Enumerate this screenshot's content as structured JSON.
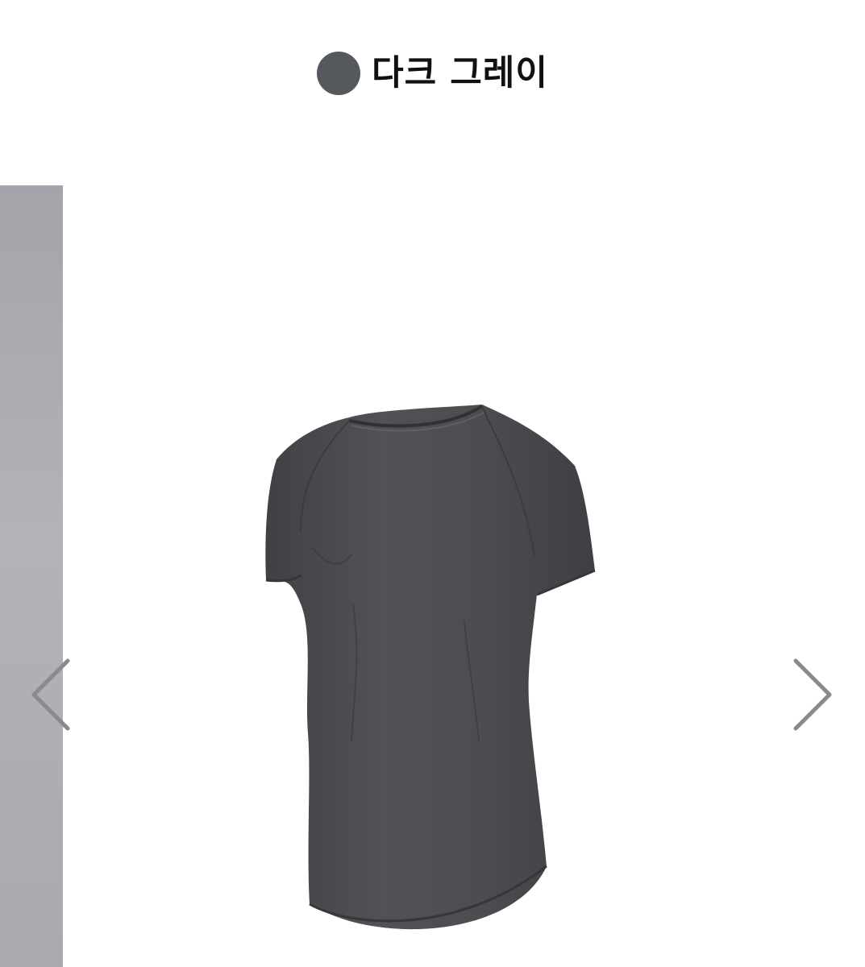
{
  "color_option": {
    "name": "다크 그레이",
    "swatch_color": "#55585d"
  },
  "product": {
    "image_icon": "short-sleeve-athletic-tshirt",
    "garment_color": "#4a4c4f"
  },
  "carousel": {
    "prev_icon": "chevron-left-icon",
    "next_icon": "chevron-right-icon"
  }
}
